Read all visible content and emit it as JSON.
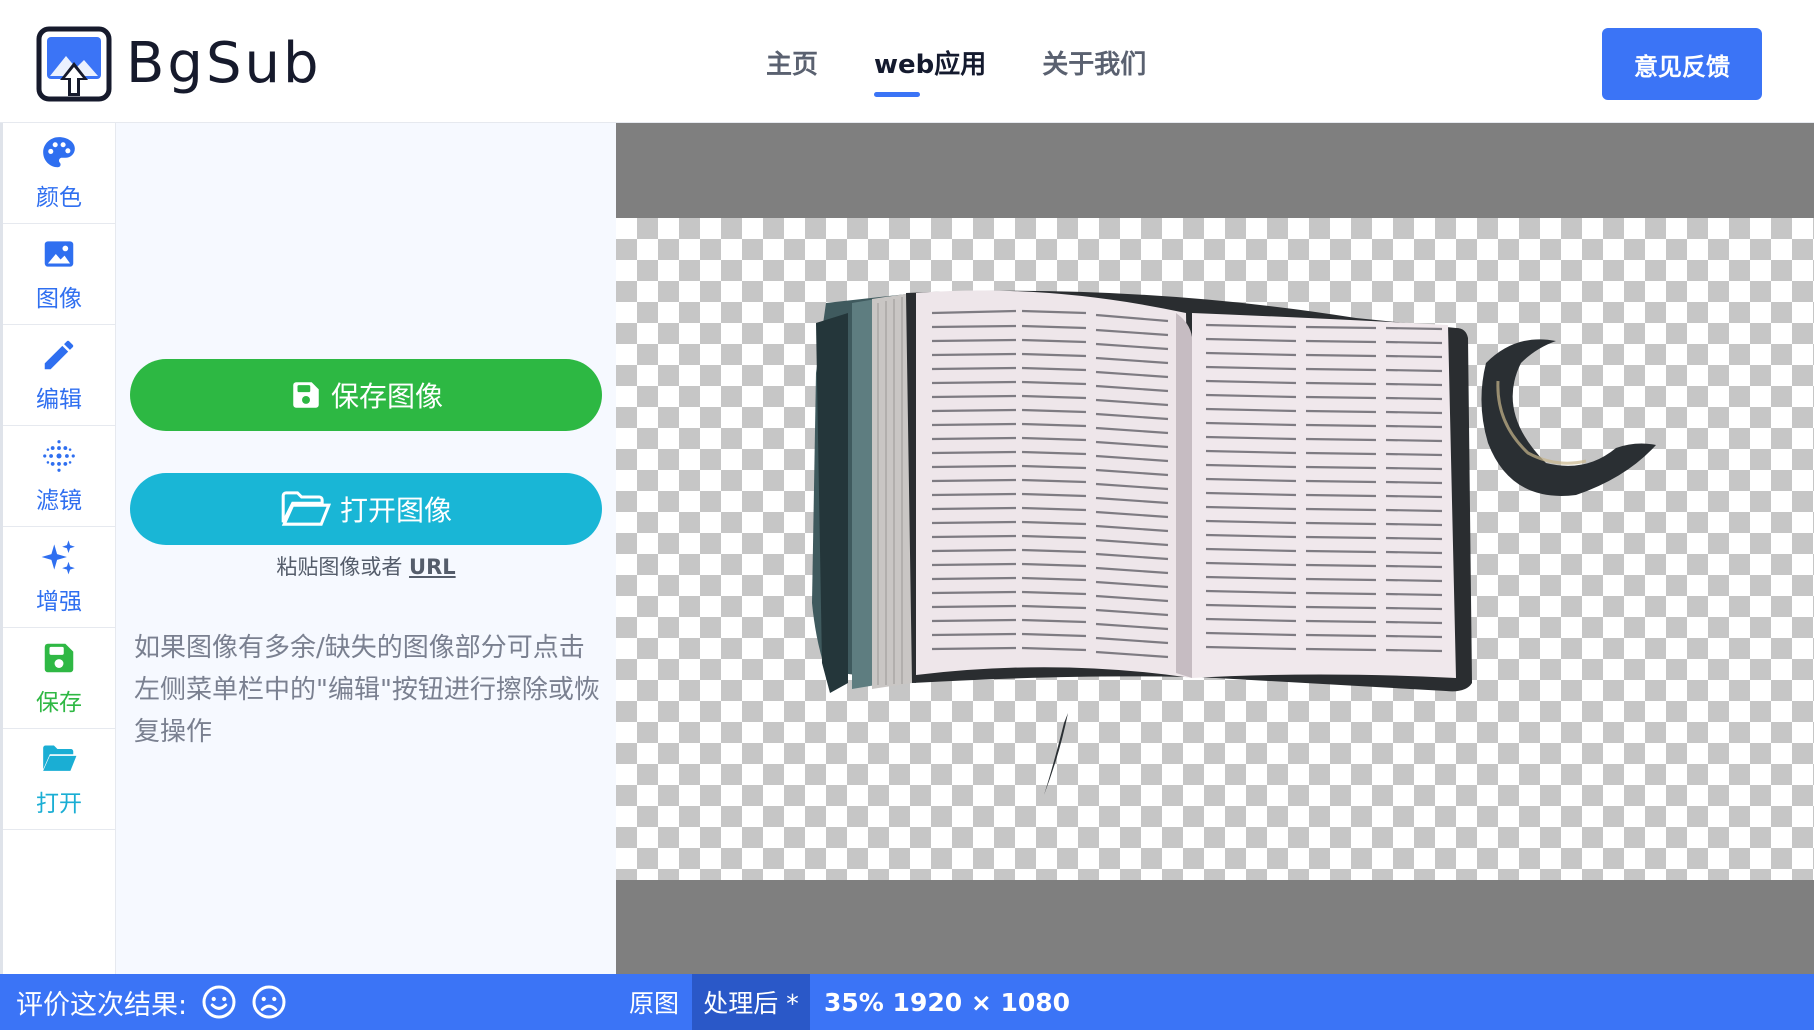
{
  "header": {
    "logo_text": "BgSub",
    "nav": [
      {
        "label": "主页",
        "active": false
      },
      {
        "label": "web应用",
        "active": true
      },
      {
        "label": "关于我们",
        "active": false
      }
    ],
    "feedback_label": "意见反馈"
  },
  "sidebar": {
    "items": [
      {
        "label": "颜色",
        "icon": "palette-icon"
      },
      {
        "label": "图像",
        "icon": "image-icon"
      },
      {
        "label": "编辑",
        "icon": "pencil-icon"
      },
      {
        "label": "滤镜",
        "icon": "filter-dots-icon"
      },
      {
        "label": "增强",
        "icon": "sparkle-icon"
      },
      {
        "label": "保存",
        "icon": "floppy-icon"
      },
      {
        "label": "打开",
        "icon": "folder-open-icon"
      }
    ]
  },
  "panel": {
    "save_label": "保存图像",
    "open_label": "打开图像",
    "paste_prefix": "粘贴图像或者",
    "paste_url": "URL",
    "hint": "如果图像有多余/缺失的图像部分可点击左侧菜单栏中的\"编辑\"按钮进行擦除或恢复操作"
  },
  "bottom": {
    "rate_label": "评价这次结果:",
    "tab_original": "原图",
    "tab_processed": "处理后 *",
    "zoom_info": "35% 1920 × 1080"
  },
  "colors": {
    "accent": "#3b74f6",
    "save_green": "#2db843",
    "open_cyan": "#19b6d6",
    "panel_bg": "#f6f9ff",
    "canvas_gray": "#7f7f7f"
  }
}
